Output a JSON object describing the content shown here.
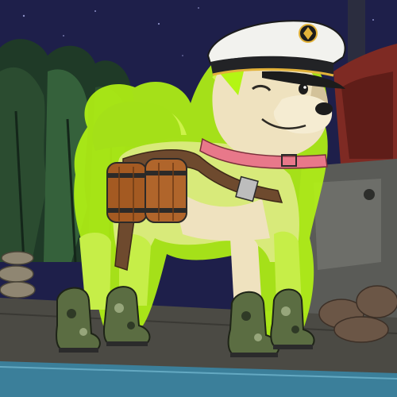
{
  "artwork": {
    "subject": "doge-sailor-dog",
    "colors": {
      "night_sky": "#1e1f4a",
      "foliage_dark": "#1f3a27",
      "foliage_mid": "#35613b",
      "ground": "#4b4a44",
      "water": "#3b7f9a",
      "fur": "#efe2bf",
      "fur_shadow": "#d3c29a",
      "glow": "#b4f514",
      "glow_light": "#e7ff6a",
      "collar": "#e8788a",
      "strap": "#6e4a2e",
      "barrel": "#a45a22",
      "barrel_band": "#2c2a28",
      "hat_white": "#f2f2ee",
      "hat_band": "#222326",
      "hat_gold": "#e2b23a",
      "boot_camo_1": "#5b6d42",
      "boot_camo_2": "#2f3a26",
      "boot_camo_3": "#97a67b",
      "ship_rust": "#7e2a23",
      "rope": "#8f8672"
    }
  }
}
